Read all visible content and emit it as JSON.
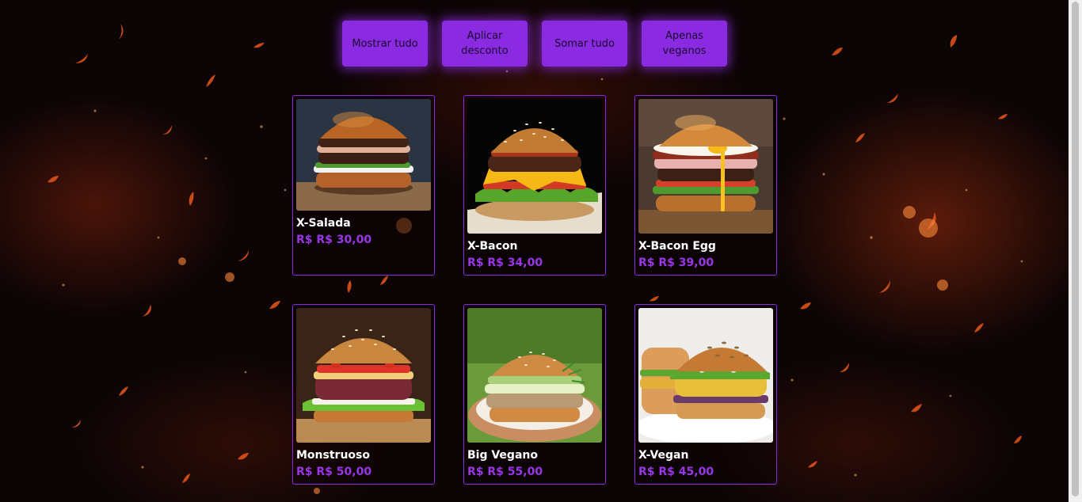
{
  "toolbar": {
    "show_all_label": "Mostrar tudo",
    "apply_discount_label": "Aplicar desconto",
    "sum_all_label": "Somar tudo",
    "vegan_only_label": "Apenas veganos"
  },
  "products": [
    {
      "name": "X-Salada",
      "price": "R$ R$ 30,00"
    },
    {
      "name": "X-Bacon",
      "price": "R$ R$ 34,00"
    },
    {
      "name": "X-Bacon Egg",
      "price": "R$ R$ 39,00"
    },
    {
      "name": "Monstruoso",
      "price": "R$ R$ 50,00"
    },
    {
      "name": "Big Vegano",
      "price": "R$ R$ 55,00"
    },
    {
      "name": "X-Vegan",
      "price": "R$ R$ 45,00"
    }
  ],
  "colors": {
    "accent": "#8a2be2",
    "price": "#9a35e8",
    "background": "#0c0405"
  }
}
